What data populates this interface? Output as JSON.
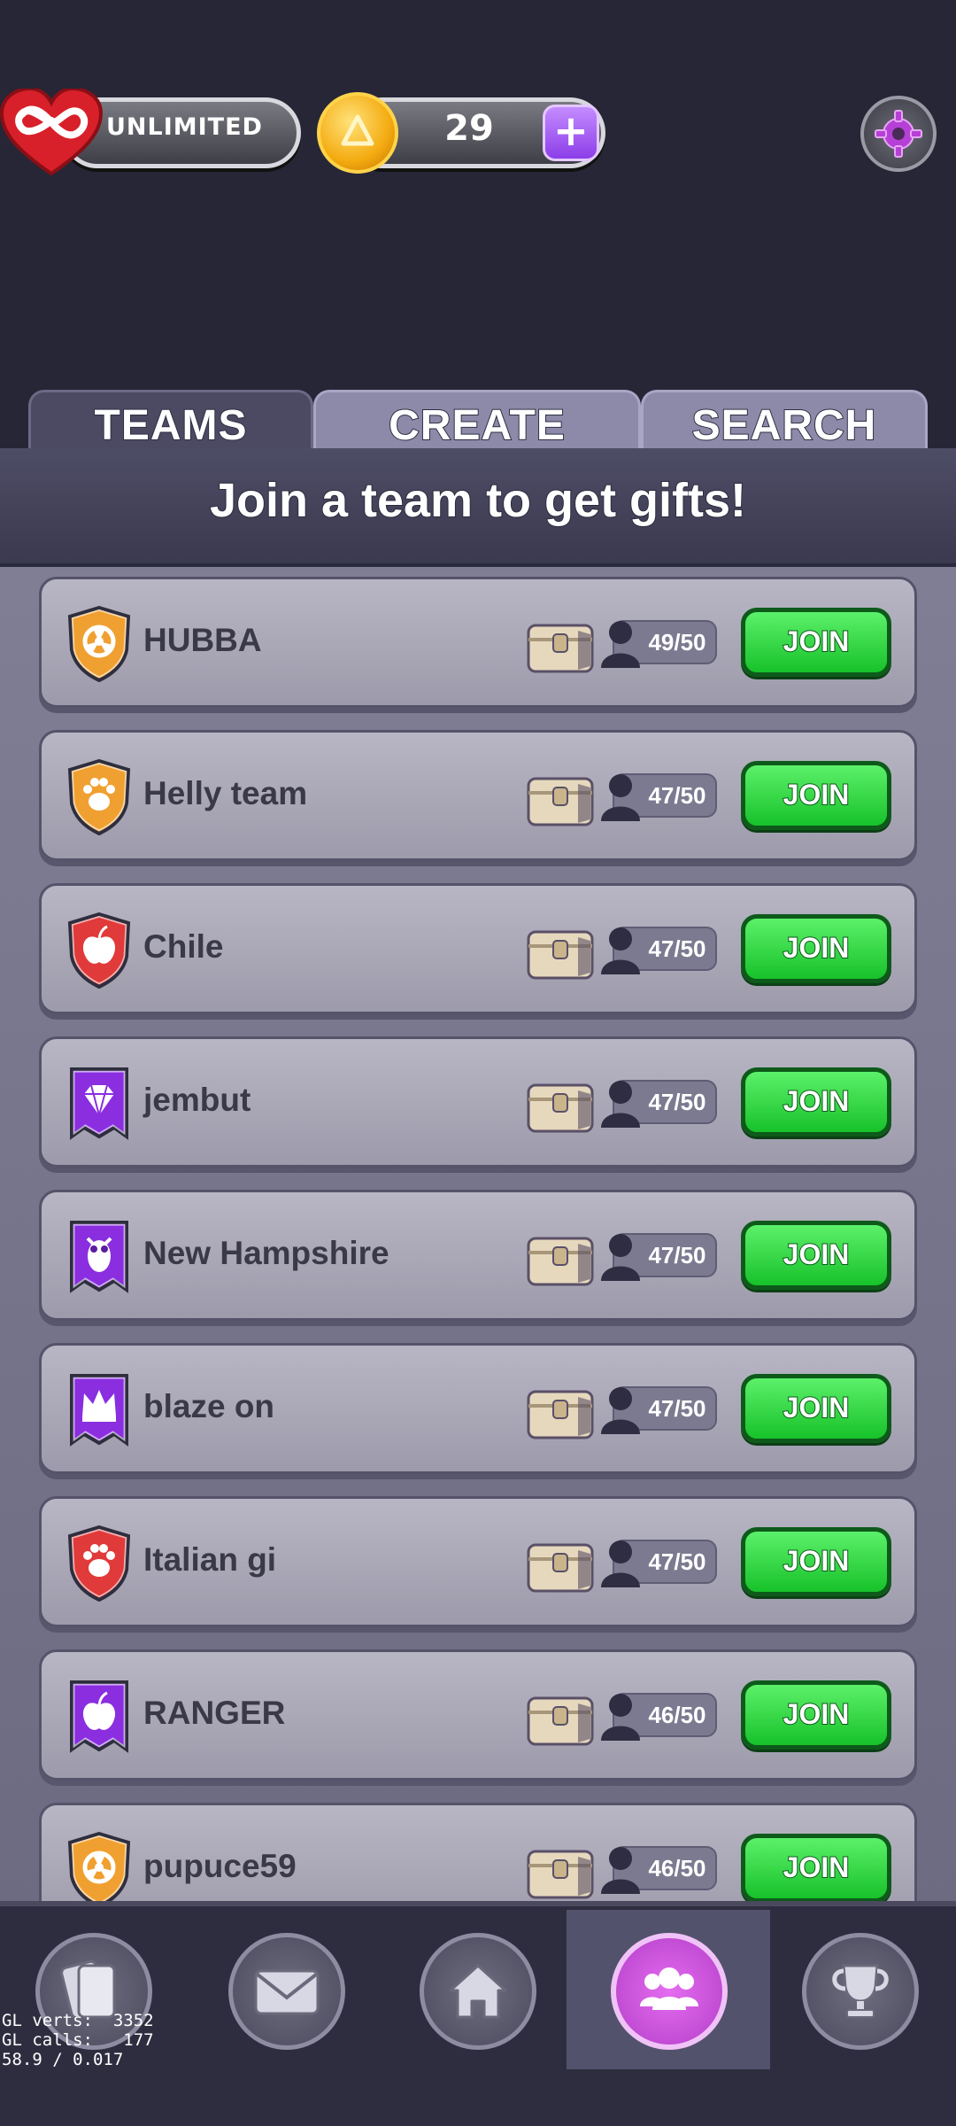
{
  "status": {
    "lives_label": "UNLIMITED",
    "coins": "29",
    "add_label": "+"
  },
  "tabs": [
    {
      "label": "TEAMS",
      "active": true
    },
    {
      "label": "CREATE",
      "active": false
    },
    {
      "label": "SEARCH",
      "active": false
    }
  ],
  "banner": "Join a team to get gifts!",
  "teams": [
    {
      "name": "HUBBA",
      "members": "49/50",
      "badge": "radiation",
      "badge_color": "#f0a030",
      "join": "JOIN"
    },
    {
      "name": "Helly team",
      "members": "47/50",
      "badge": "paw",
      "badge_color": "#f0a030",
      "join": "JOIN"
    },
    {
      "name": "Chile",
      "members": "47/50",
      "badge": "apple",
      "badge_color": "#e03a3a",
      "join": "JOIN"
    },
    {
      "name": "jembut",
      "members": "47/50",
      "badge": "diamond",
      "badge_color": "#8a2ee0",
      "join": "JOIN"
    },
    {
      "name": "New Hampshire",
      "members": "47/50",
      "badge": "owl",
      "badge_color": "#8a2ee0",
      "join": "JOIN"
    },
    {
      "name": "blaze on",
      "members": "47/50",
      "badge": "crown",
      "badge_color": "#8a2ee0",
      "join": "JOIN"
    },
    {
      "name": "Italian gi",
      "members": "47/50",
      "badge": "paw",
      "badge_color": "#e03a3a",
      "join": "JOIN"
    },
    {
      "name": "RANGER",
      "members": "46/50",
      "badge": "apple",
      "badge_color": "#8a2ee0",
      "join": "JOIN"
    },
    {
      "name": "pupuce59",
      "members": "46/50",
      "badge": "radiation",
      "badge_color": "#f0a030",
      "join": "JOIN"
    }
  ],
  "nav": [
    {
      "name": "cards",
      "icon": "cards-icon",
      "active": false
    },
    {
      "name": "inbox",
      "icon": "envelope-icon",
      "active": false
    },
    {
      "name": "home",
      "icon": "home-icon",
      "active": false
    },
    {
      "name": "teams",
      "icon": "team-icon",
      "active": true
    },
    {
      "name": "leaderboard",
      "icon": "trophy-icon",
      "active": false
    }
  ],
  "debug": {
    "line1": "GL verts:  3352",
    "line2": "GL calls:   177",
    "line3": "58.9 / 0.017"
  }
}
